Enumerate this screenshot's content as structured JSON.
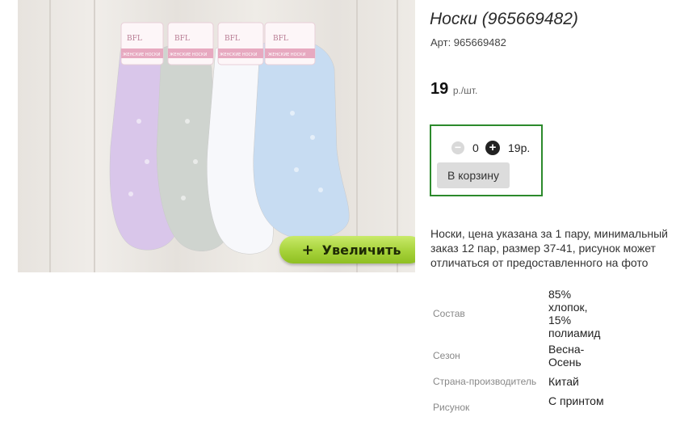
{
  "product": {
    "title": "Носки (965669482)",
    "sku_label": "Арт: 965669482",
    "price_value": "19",
    "price_unit": "р./шт.",
    "description": "Носки, цена указана за 1 пару, минимальный заказ 12 пар, размер 37-41, рисунок может отличаться от предоставленного на фото"
  },
  "image": {
    "zoom_label": "Увеличить",
    "zoom_plus": "+",
    "brand": "BFL",
    "pack_label": "ЖЕНСКИЕ НОСКИ",
    "sock_colors": [
      "#d9c6ea",
      "#cfd4cf",
      "#f7f8fb",
      "#c7dcf2"
    ]
  },
  "cart": {
    "minus": "−",
    "quantity": "0",
    "plus": "+",
    "sum": "19р.",
    "add_button": "В корзину"
  },
  "specs": [
    {
      "label": "Состав",
      "value": "85% хлопок, 15% полиамид"
    },
    {
      "label": "Сезон",
      "value": "Весна-Осень"
    },
    {
      "label": "Страна-производитель",
      "value": "Китай"
    },
    {
      "label": "Рисунок",
      "value": "С принтом"
    }
  ],
  "colors": {
    "accent_border": "#2c8a2c",
    "zoom_button": "#a6d23a"
  }
}
